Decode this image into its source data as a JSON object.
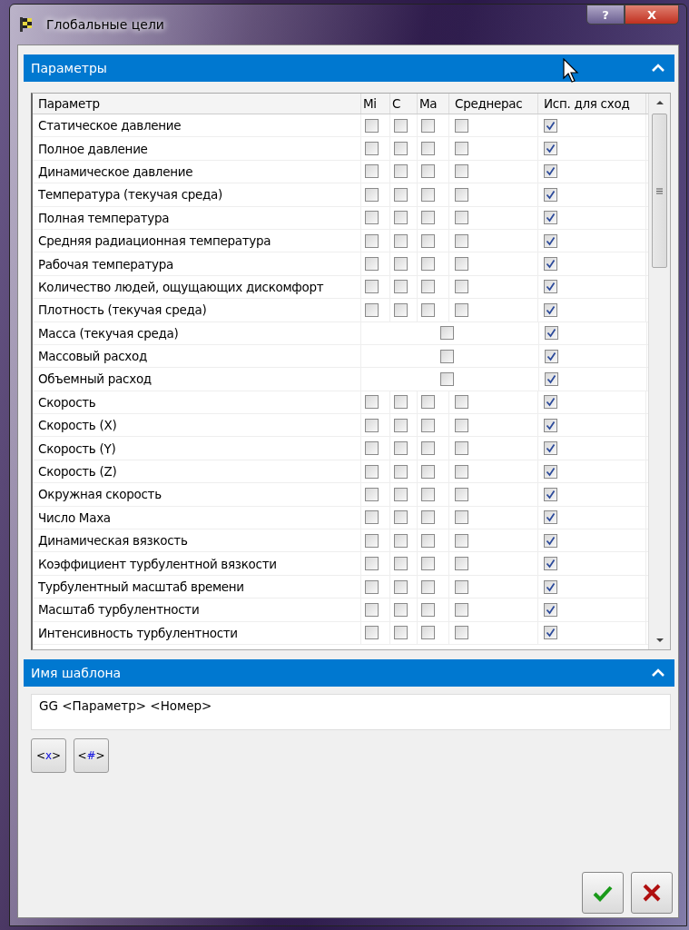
{
  "window": {
    "title": "Глобальные цели",
    "buttons": [
      "?",
      "X"
    ]
  },
  "parameters_panel": {
    "title": "Параметры",
    "expanded": true,
    "columns": [
      "Параметр",
      "Mi",
      "С",
      "Ma",
      "Среднерас",
      "Исп. для сход"
    ],
    "rows": [
      {
        "name": "Статическое давление",
        "kind": "full",
        "min": false,
        "avg": false,
        "max": false,
        "bulk": false,
        "goal": true
      },
      {
        "name": "Полное давление",
        "kind": "full",
        "min": false,
        "avg": false,
        "max": false,
        "bulk": false,
        "goal": true
      },
      {
        "name": "Динамическое давление",
        "kind": "full",
        "min": false,
        "avg": false,
        "max": false,
        "bulk": false,
        "goal": true
      },
      {
        "name": "Температура (текучая среда)",
        "kind": "full",
        "min": false,
        "avg": false,
        "max": false,
        "bulk": false,
        "goal": true
      },
      {
        "name": "Полная температура",
        "kind": "full",
        "min": false,
        "avg": false,
        "max": false,
        "bulk": false,
        "goal": true
      },
      {
        "name": "Средняя радиационная температура",
        "kind": "full",
        "min": false,
        "avg": false,
        "max": false,
        "bulk": false,
        "goal": true
      },
      {
        "name": "Рабочая температура",
        "kind": "full",
        "min": false,
        "avg": false,
        "max": false,
        "bulk": false,
        "goal": true
      },
      {
        "name": "Количество людей, ощущающих дискомфорт",
        "kind": "full",
        "min": false,
        "avg": false,
        "max": false,
        "bulk": false,
        "goal": true
      },
      {
        "name": "Плотность (текучая среда)",
        "kind": "full",
        "min": false,
        "avg": false,
        "max": false,
        "bulk": false,
        "goal": true
      },
      {
        "name": "Масса (текучая среда)",
        "kind": "single",
        "value": false,
        "goal": true
      },
      {
        "name": "Массовый расход",
        "kind": "single",
        "value": false,
        "goal": true
      },
      {
        "name": "Объемный расход",
        "kind": "single",
        "value": false,
        "goal": true
      },
      {
        "name": "Скорость",
        "kind": "full",
        "min": false,
        "avg": false,
        "max": false,
        "bulk": false,
        "goal": true
      },
      {
        "name": "Скорость (X)",
        "kind": "full",
        "min": false,
        "avg": false,
        "max": false,
        "bulk": false,
        "goal": true
      },
      {
        "name": "Скорость (Y)",
        "kind": "full",
        "min": false,
        "avg": false,
        "max": false,
        "bulk": false,
        "goal": true
      },
      {
        "name": "Скорость (Z)",
        "kind": "full",
        "min": false,
        "avg": false,
        "max": false,
        "bulk": false,
        "goal": true
      },
      {
        "name": "Окружная скорость",
        "kind": "full",
        "min": false,
        "avg": false,
        "max": false,
        "bulk": false,
        "goal": true
      },
      {
        "name": "Число Маха",
        "kind": "full",
        "min": false,
        "avg": false,
        "max": false,
        "bulk": false,
        "goal": true
      },
      {
        "name": "Динамическая вязкость",
        "kind": "full",
        "min": false,
        "avg": false,
        "max": false,
        "bulk": false,
        "goal": true
      },
      {
        "name": "Коэффициент турбулентной вязкости",
        "kind": "full",
        "min": false,
        "avg": false,
        "max": false,
        "bulk": false,
        "goal": true
      },
      {
        "name": "Турбулентный масштаб времени",
        "kind": "full",
        "min": false,
        "avg": false,
        "max": false,
        "bulk": false,
        "goal": true
      },
      {
        "name": "Масштаб турбулентности",
        "kind": "full",
        "min": false,
        "avg": false,
        "max": false,
        "bulk": false,
        "goal": true
      },
      {
        "name": "Интенсивность турбулентности",
        "kind": "full",
        "min": false,
        "avg": false,
        "max": false,
        "bulk": false,
        "goal": true
      }
    ]
  },
  "template_panel": {
    "title": "Имя шаблона",
    "expanded": true,
    "value": "GG <Параметр> <Номер>",
    "insert_buttons": [
      {
        "text": "<x>"
      },
      {
        "text": "<#>"
      }
    ]
  },
  "footer_buttons": [
    {
      "kind": "ok"
    },
    {
      "kind": "cancel"
    }
  ]
}
